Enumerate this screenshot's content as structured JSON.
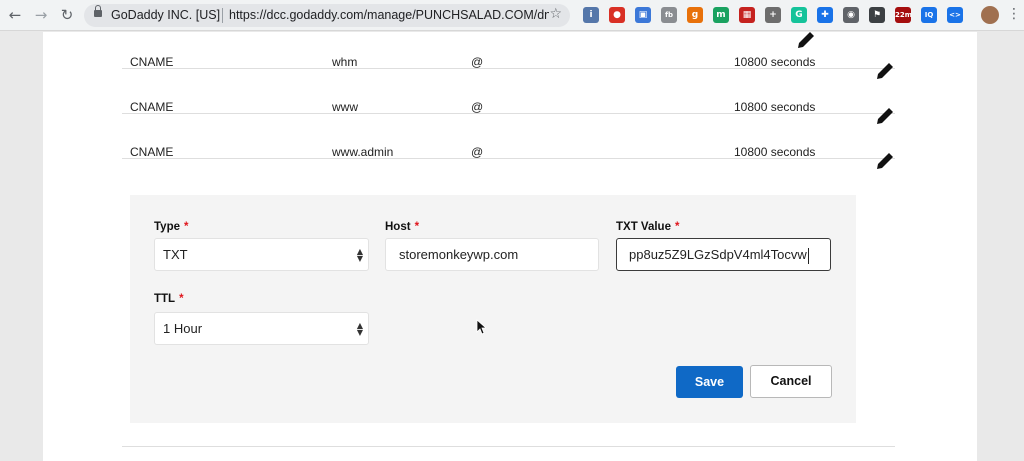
{
  "browser": {
    "org": "GoDaddy INC. [US]",
    "url": "https://dcc.godaddy.com/manage/PUNCHSALAD.COM/dns",
    "extensions": [
      {
        "name": "ext-circle-blue-icon",
        "color": "#5577aa",
        "glyph": "i"
      },
      {
        "name": "ext-red-stop-icon",
        "color": "#d93025",
        "glyph": "●"
      },
      {
        "name": "ext-blue-square-icon",
        "color": "#3c78d8",
        "glyph": "▣"
      },
      {
        "name": "ext-fb-icon",
        "color": "#8a8d91",
        "glyph": "fb"
      },
      {
        "name": "ext-gift-icon",
        "color": "#e8710a",
        "glyph": "g"
      },
      {
        "name": "ext-green-m-icon",
        "color": "#1aa260",
        "glyph": "m"
      },
      {
        "name": "ext-red-grid-icon",
        "color": "#c5221f",
        "glyph": "▦"
      },
      {
        "name": "ext-gray-circle-icon",
        "color": "#6d6d6d",
        "glyph": "+"
      },
      {
        "name": "ext-grammarly-icon",
        "color": "#15c39a",
        "glyph": "G"
      },
      {
        "name": "ext-puzzle-icon",
        "color": "#1a73e8",
        "glyph": "✚"
      },
      {
        "name": "ext-camera-icon",
        "color": "#5f6368",
        "glyph": "◉"
      },
      {
        "name": "ext-flag-icon",
        "color": "#3c4043",
        "glyph": "⚑"
      },
      {
        "name": "ext-timer-icon",
        "color": "#a50e0e",
        "glyph": "22m"
      },
      {
        "name": "ext-iq-icon",
        "color": "#1a73e8",
        "glyph": "IQ"
      },
      {
        "name": "ext-code-icon",
        "color": "#1a73e8",
        "glyph": "<>"
      }
    ]
  },
  "records": [
    {
      "type": "CNAME",
      "host": "whm",
      "points_to": "@",
      "ttl": "10800 seconds"
    },
    {
      "type": "CNAME",
      "host": "www",
      "points_to": "@",
      "ttl": "10800 seconds"
    },
    {
      "type": "CNAME",
      "host": "www.admin",
      "points_to": "@",
      "ttl": "10800 seconds"
    }
  ],
  "form": {
    "type_label": "Type",
    "type_value": "TXT",
    "host_label": "Host",
    "host_value": "storemonkeywp.com",
    "txt_label": "TXT Value",
    "txt_value": "pp8uz5Z9LGzSdpV4ml4Tocvw",
    "ttl_label": "TTL",
    "ttl_value": "1 Hour",
    "required_marker": "*",
    "save_label": "Save",
    "cancel_label": "Cancel"
  },
  "colors": {
    "primary": "#0f69c6",
    "required": "#e0161d"
  }
}
